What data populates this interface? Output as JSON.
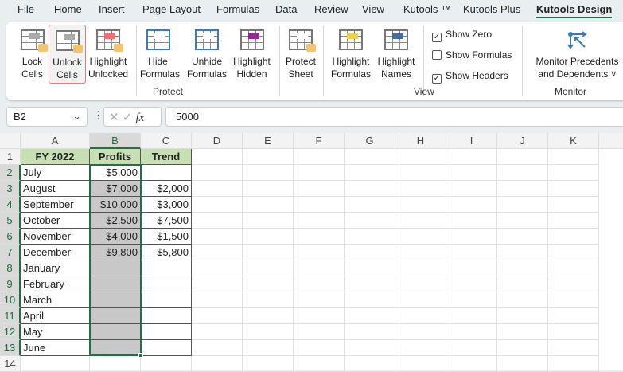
{
  "menu": [
    "File",
    "Home",
    "Insert",
    "Page Layout",
    "Formulas",
    "Data",
    "Review",
    "View",
    "Kutools ™",
    "Kutools Plus",
    "Kutools Design"
  ],
  "ribbon": {
    "buttons": [
      {
        "l1": "Lock",
        "l2": "Cells",
        "icon": "lock-cells-icon"
      },
      {
        "l1": "Unlock",
        "l2": "Cells",
        "icon": "unlock-cells-icon"
      },
      {
        "l1": "Highlight",
        "l2": "Unlocked",
        "icon": "highlight-unlocked-icon"
      },
      {
        "l1": "Hide",
        "l2": "Formulas",
        "icon": "hide-formulas-icon"
      },
      {
        "l1": "Unhide",
        "l2": "Formulas",
        "icon": "unhide-formulas-icon"
      },
      {
        "l1": "Highlight",
        "l2": "Hidden",
        "icon": "highlight-hidden-icon"
      },
      {
        "l1": "Protect",
        "l2": "Sheet",
        "icon": "protect-sheet-icon"
      },
      {
        "l1": "Highlight",
        "l2": "Formulas",
        "icon": "highlight-formulas-icon"
      },
      {
        "l1": "Highlight",
        "l2": "Names",
        "icon": "highlight-names-icon"
      }
    ],
    "checks": [
      {
        "label": "Show Zero",
        "checked": true
      },
      {
        "label": "Show Formulas",
        "checked": false
      },
      {
        "label": "Show Headers",
        "checked": true
      }
    ],
    "monitor": {
      "l1": "Monitor Precedents",
      "l2": "and Dependents ˅"
    },
    "groups": [
      "Protect",
      "View",
      "Monitor"
    ]
  },
  "namebox": "B2",
  "formula": "5000",
  "fx": "fx",
  "columns": [
    "A",
    "B",
    "C",
    "D",
    "E",
    "F",
    "G",
    "H",
    "I",
    "J",
    "K"
  ],
  "rows": [
    [
      "FY 2022",
      "Profits",
      "Trend"
    ],
    [
      "July",
      "$5,000",
      ""
    ],
    [
      "August",
      "$7,000",
      "$2,000"
    ],
    [
      "September",
      "$10,000",
      "$3,000"
    ],
    [
      "October",
      "$2,500",
      "-$7,500"
    ],
    [
      "November",
      "$4,000",
      "$1,500"
    ],
    [
      "December",
      "$9,800",
      "$5,800"
    ],
    [
      "January",
      "",
      ""
    ],
    [
      "February",
      "",
      ""
    ],
    [
      "March",
      "",
      ""
    ],
    [
      "April",
      "",
      ""
    ],
    [
      "May",
      "",
      ""
    ],
    [
      "June",
      "",
      ""
    ],
    [
      "",
      "",
      ""
    ]
  ],
  "colors": {
    "header_fill": "#c6e0b4",
    "locked_fill": "#c8c8c8",
    "accent": "#1e7145"
  }
}
